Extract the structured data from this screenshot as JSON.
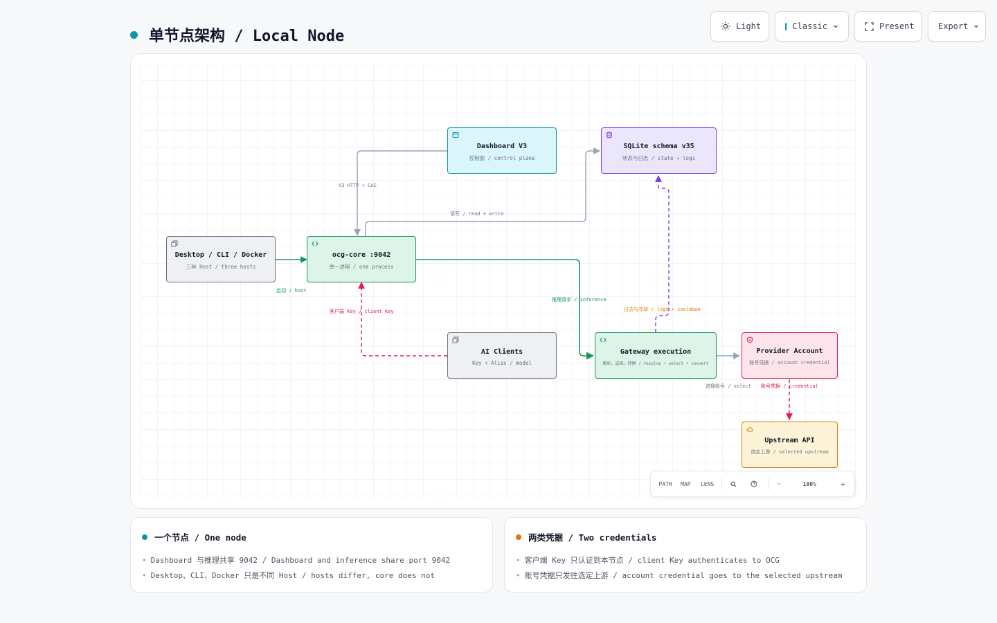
{
  "page": {
    "title": "单节点架构 / Local Node",
    "accent": "#0e93ad"
  },
  "toolbar": {
    "theme_label": "Light",
    "style_label": "Classic",
    "present_label": "Present",
    "export_label": "Export"
  },
  "diagram": {
    "nodes": {
      "desktop": {
        "title": "Desktop / CLI / Docker",
        "subtitle": "三种 Host / three hosts",
        "icon": "window-icon"
      },
      "core": {
        "title": "ocg-core :9042",
        "subtitle": "单一进程 / one process",
        "icon": "code-icon"
      },
      "dashboard": {
        "title": "Dashboard V3",
        "subtitle": "控制面 / control plane",
        "icon": "browser-icon"
      },
      "sqlite": {
        "title": "SQLite schema v35",
        "subtitle": "状态与日志 / state + logs",
        "icon": "database-icon"
      },
      "aiclients": {
        "title": "AI Clients",
        "subtitle": "Key + Alias / model",
        "icon": "window-icon"
      },
      "gateway": {
        "title": "Gateway execution",
        "subtitle": "解析、选择、转换 / resolve + select + convert",
        "icon": "code-icon"
      },
      "provider": {
        "title": "Provider Account",
        "subtitle": "账号凭据 / account credential",
        "icon": "shield-icon"
      },
      "upstream": {
        "title": "Upstream API",
        "subtitle": "选定上游 / selected upstream",
        "icon": "cloud-icon"
      }
    },
    "edges": {
      "host": "启动 / host",
      "v3http": "V3 HTTP + CAS",
      "readwrite": "读写 / read + write",
      "clientkey": "客户端 Key / client Key",
      "inference": "推理请求 / inference",
      "logs": "日志与冷却 / logs + cooldown",
      "select": "选择账号 / select",
      "credential": "账号凭据 / credential"
    },
    "colors": {
      "gray": "#6b7280",
      "green": "#16955a",
      "purple": "#7c3aed",
      "red": "#e11d48",
      "orange": "#d97706",
      "edge_gray": "#94a3b8"
    }
  },
  "controls": {
    "path": "PATH",
    "map": "MAP",
    "lens": "LENS",
    "zoom": "100%",
    "zoom_out": "−",
    "zoom_in": "+"
  },
  "cards": {
    "node": {
      "title": "一个节点 / One node",
      "accent": "#0e93ad",
      "items": [
        "Dashboard 与推理共享 9042 / Dashboard and inference share port 9042",
        "Desktop、CLI、Docker 只是不同 Host / hosts differ, core does not"
      ]
    },
    "credentials": {
      "title": "两类凭据 / Two credentials",
      "accent": "#d97706",
      "items": [
        "客户端 Key 只认证到本节点 / client Key authenticates to OCG",
        "账号凭据只发往选定上游 / account credential goes to the selected upstream"
      ]
    }
  }
}
